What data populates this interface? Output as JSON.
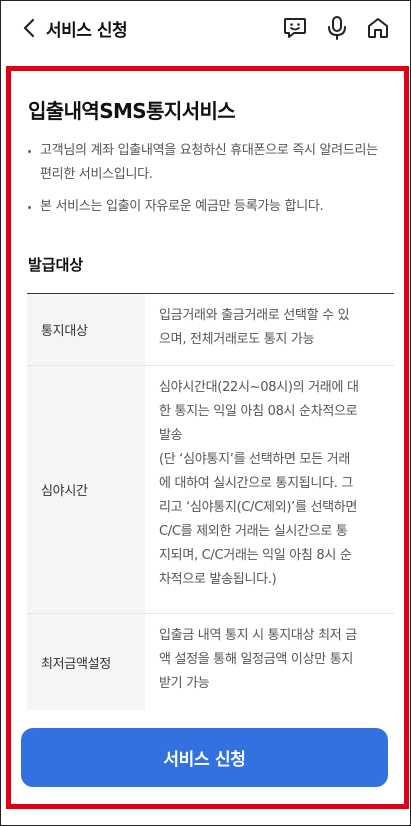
{
  "header": {
    "title": "서비스 신청",
    "icons": [
      "back-arrow-icon",
      "chat-icon",
      "microphone-icon",
      "home-icon"
    ]
  },
  "main": {
    "page_title": "입출내역SMS통지서비스",
    "bullets": [
      "고객님의 계좌 입출내역을 요청하신 휴대폰으로 즉시 알려드리는 편리한 서비스입니다.",
      "본 서비스는 입출이 자유로운 예금만 등록가능 합니다."
    ],
    "section_title": "발급대상",
    "table": [
      {
        "label": "통지대상",
        "lines": [
          "입금거래와 출금거래로 선택할 수 있",
          "으며, 전체거래로도 통지 가능"
        ]
      },
      {
        "label": "심야시간",
        "lines": [
          "심야시간대(22시~08시)의 거래에 대",
          "한 통지는 익일 아침 08시 순차적으로",
          "발송",
          "(단 ‘심야통지’를 선택하면 모든 거래",
          "에 대하여 실시간으로 통지됩니다. 그",
          "리고 ‘심야통지(C/C제외)’를 선택하면",
          "C/C를 제외한 거래는 실시간으로 통",
          "지되며, C/C거래는 익일 아침 8시 순",
          "차적으로 발송됩니다.)"
        ]
      },
      {
        "label": "최저금액설정",
        "lines": [
          "입출금 내역 통지 시 통지대상 최저 금",
          "액 설정을 통해 일정금액 이상만 통지",
          "받기 가능"
        ]
      }
    ],
    "cta_label": "서비스 신청"
  },
  "colors": {
    "accent": "#3371e0",
    "highlight_border": "#e00012"
  }
}
